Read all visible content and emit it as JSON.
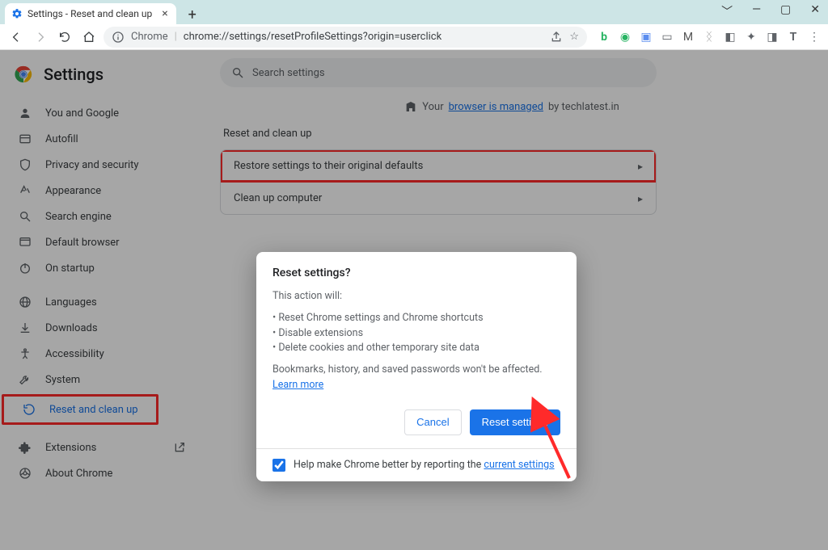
{
  "window": {
    "tab_title": "Settings - Reset and clean up"
  },
  "toolbar": {
    "chrome_label": "Chrome",
    "url": "chrome://settings/resetProfileSettings?origin=userclick"
  },
  "settings": {
    "app_title": "Settings",
    "search_placeholder": "Search settings",
    "managed": {
      "prefix": "Your ",
      "link": "browser is managed",
      "suffix": " by techlatest.in"
    },
    "section_title": "Reset and clean up",
    "cards": {
      "restore": "Restore settings to their original defaults",
      "cleanup": "Clean up computer"
    },
    "sidebar": [
      {
        "label": "You and Google"
      },
      {
        "label": "Autofill"
      },
      {
        "label": "Privacy and security"
      },
      {
        "label": "Appearance"
      },
      {
        "label": "Search engine"
      },
      {
        "label": "Default browser"
      },
      {
        "label": "On startup"
      },
      {
        "label": "Languages"
      },
      {
        "label": "Downloads"
      },
      {
        "label": "Accessibility"
      },
      {
        "label": "System"
      },
      {
        "label": "Reset and clean up"
      },
      {
        "label": "Extensions"
      },
      {
        "label": "About Chrome"
      }
    ]
  },
  "dialog": {
    "title": "Reset settings?",
    "intro": "This action will:",
    "bullets": [
      "Reset Chrome settings and Chrome shortcuts",
      "Disable extensions",
      "Delete cookies and other temporary site data"
    ],
    "note_prefix": "Bookmarks, history, and saved passwords won't be affected. ",
    "note_link": "Learn more",
    "cancel": "Cancel",
    "confirm": "Reset settings",
    "report_prefix": "Help make Chrome better by reporting the ",
    "report_link": "current settings"
  }
}
